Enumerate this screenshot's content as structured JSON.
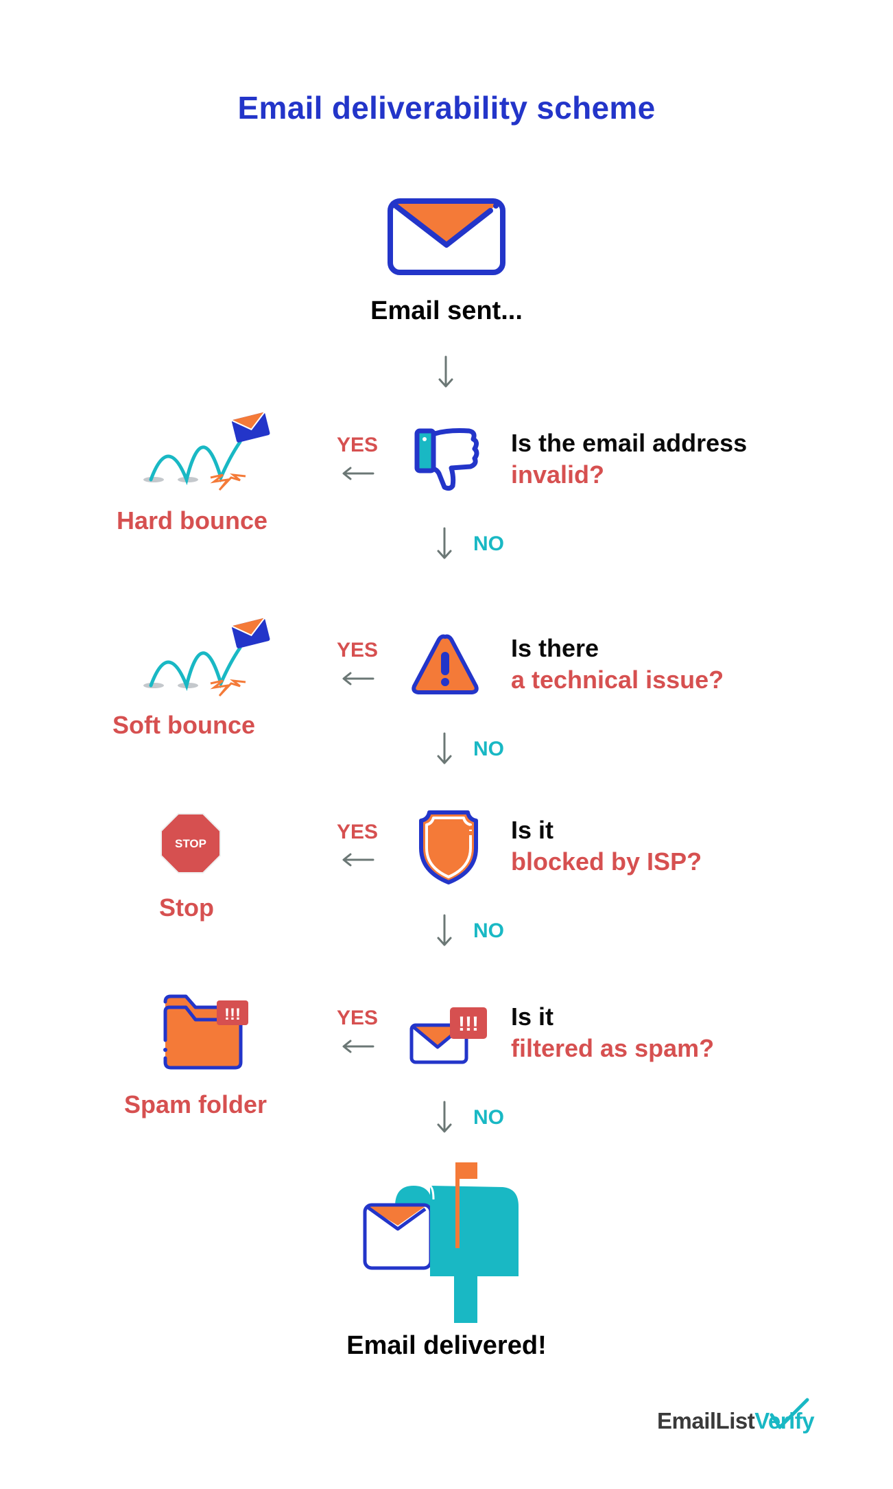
{
  "title": "Email deliverability scheme",
  "start": {
    "label": "Email sent...",
    "icon": "envelope-icon"
  },
  "yes_label": "YES",
  "no_label": "NO",
  "steps": [
    {
      "question_line1": "Is the email address",
      "question_line2": "invalid?",
      "icon": "thumbs-down-icon",
      "outcome": "Hard bounce",
      "outcome_icon": "hard-bounce-icon"
    },
    {
      "question_line1": "Is there",
      "question_line2": "a technical issue?",
      "icon": "warning-triangle-icon",
      "outcome": "Soft bounce",
      "outcome_icon": "soft-bounce-icon"
    },
    {
      "question_line1": "Is it",
      "question_line2": "blocked by ISP?",
      "icon": "shield-icon",
      "outcome": "Stop",
      "outcome_icon": "stop-sign-icon",
      "stop_sign_text": "STOP"
    },
    {
      "question_line1": "Is it",
      "question_line2": "filtered as spam?",
      "icon": "spam-envelope-icon",
      "outcome": "Spam folder",
      "outcome_icon": "spam-folder-icon",
      "badge_text": "!!!"
    }
  ],
  "end": {
    "label": "Email delivered!",
    "icon": "mailbox-icon"
  },
  "logo": {
    "part1": "EmailList",
    "part2": "Verify"
  },
  "colors": {
    "blue": "#2335c9",
    "orange": "#f47a38",
    "red": "#d65050",
    "teal": "#19b8c4",
    "arrow": "#6b7775",
    "text": "#0a0a0a"
  }
}
